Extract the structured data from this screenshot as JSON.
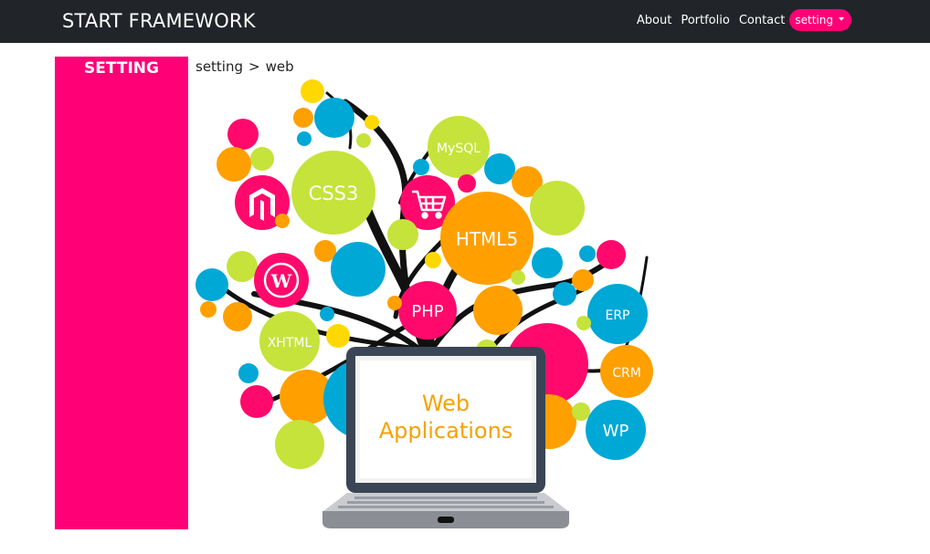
{
  "navbar": {
    "brand": "START FRAMEWORK",
    "links": [
      "About",
      "Portfolio",
      "Contact"
    ],
    "dropdown": {
      "label": "setting"
    }
  },
  "sidebar": {
    "title": "SETTING"
  },
  "breadcrumb": {
    "items": [
      "setting",
      "web"
    ],
    "separator": ">"
  },
  "illustration": {
    "bubbles": [
      "CSS3",
      "MySQL",
      "HTML5",
      "PHP",
      "XHTML",
      "ERP",
      "CRM",
      "WP"
    ],
    "screen_text": [
      "Web",
      "Applications"
    ],
    "icons": [
      "magento-icon",
      "shopping-cart-icon",
      "wordpress-icon"
    ]
  },
  "colors": {
    "navbar_bg": "#212529",
    "accent_pink": "#ff0077",
    "lime": "#c5e33b",
    "blue": "#00a8d6",
    "orange": "#ffa000",
    "yellow": "#ffd800",
    "magenta": "#ff0a6c"
  }
}
